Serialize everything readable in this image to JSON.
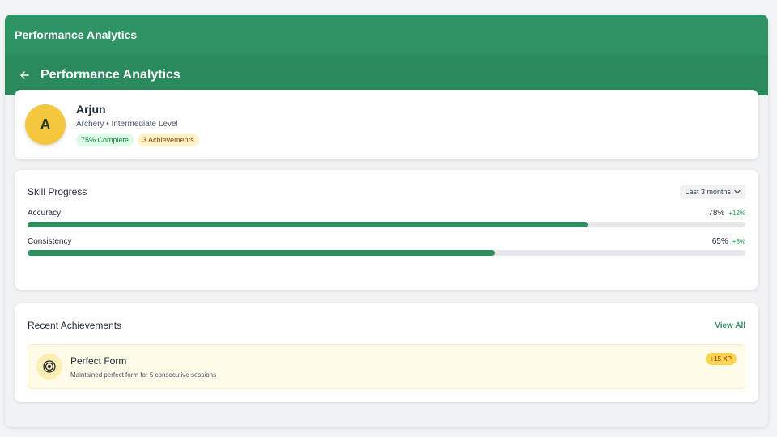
{
  "window": {
    "title": "Performance Analytics"
  },
  "header": {
    "title": "Performance Analytics",
    "back_icon": "arrow-left-icon"
  },
  "profile": {
    "avatar_letter": "A",
    "name": "Arjun",
    "subtitle": "Archery • Intermediate Level",
    "badges": [
      "75% Complete",
      "3 Achievements"
    ],
    "avatar_color": "#f5c73d"
  },
  "skills": {
    "title": "Skill Progress",
    "range": "Last 3 months",
    "items": [
      {
        "name": "Accuracy",
        "value": "78%",
        "delta": "+12%",
        "level": 0.78
      },
      {
        "name": "Consistency",
        "value": "65%",
        "delta": "+8%",
        "level": 0.65
      }
    ]
  },
  "achievements": {
    "title": "Recent Achievements",
    "view_all": "View All",
    "items": [
      {
        "title": "Perfect Form",
        "description": "Maintained perfect form for 5 consecutive sessions",
        "xp": "+15 XP",
        "icon": "target-icon"
      }
    ]
  },
  "colors": {
    "primary": "#2f9465",
    "header": "#2b8a5d",
    "progress": "#2f8f5f",
    "badge_green": "#dcfce7",
    "badge_yellow": "#fef3c7"
  }
}
